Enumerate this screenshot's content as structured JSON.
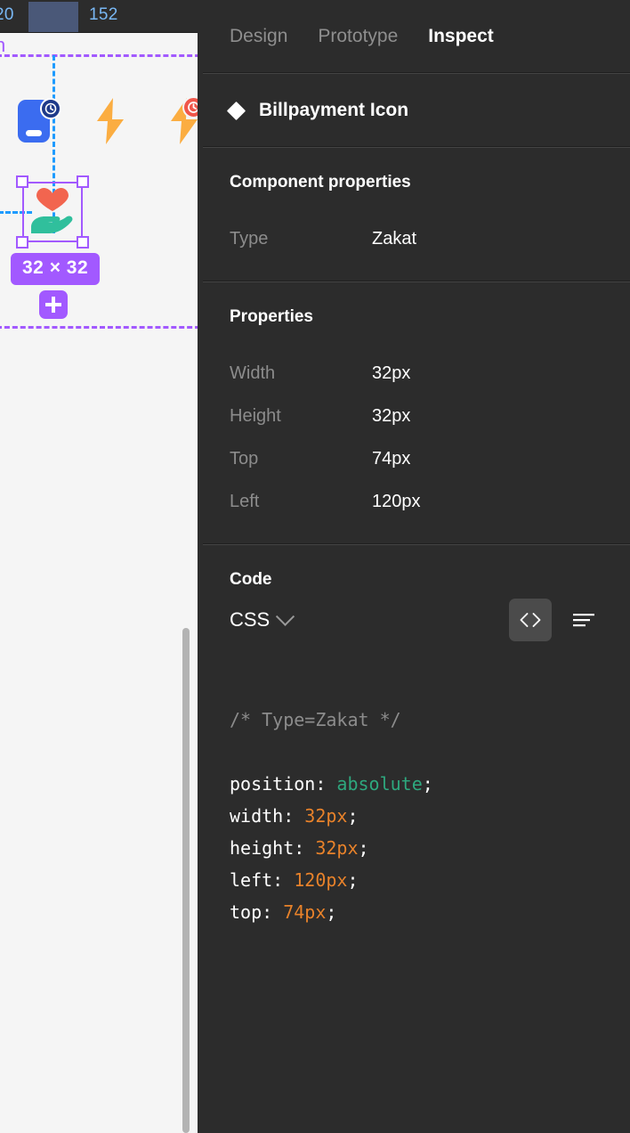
{
  "canvas": {
    "ruler": {
      "tick_left": "20",
      "tick_right": "152"
    },
    "frame_name_fragment": "n",
    "selection": {
      "size_badge": "32 × 32",
      "add_button": "+"
    },
    "icons": [
      "phone-card-icon",
      "lightning-bolt-icon",
      "lightning-bolt-badged-icon",
      "zakat-heart-hand-icon"
    ],
    "colors": {
      "selection_purple": "#a259ff",
      "guide_blue": "#1e9bff",
      "canvas_bg": "#f5f5f5",
      "ruler_highlight": "#4a5878",
      "ruler_text": "#79b8f5"
    }
  },
  "panel": {
    "tabs": [
      {
        "label": "Design",
        "active": false
      },
      {
        "label": "Prototype",
        "active": false
      },
      {
        "label": "Inspect",
        "active": true
      }
    ],
    "component": {
      "name": "Billpayment Icon",
      "icon": "component-diamond-icon"
    },
    "component_properties": {
      "title": "Component properties",
      "rows": [
        {
          "label": "Type",
          "value": "Zakat"
        }
      ]
    },
    "properties": {
      "title": "Properties",
      "rows": [
        {
          "label": "Width",
          "value": "32px"
        },
        {
          "label": "Height",
          "value": "32px"
        },
        {
          "label": "Top",
          "value": "74px"
        },
        {
          "label": "Left",
          "value": "120px"
        }
      ]
    },
    "code": {
      "title": "Code",
      "language": "CSS",
      "comment": "/* Type=Zakat */",
      "lines": [
        {
          "prop": "position: ",
          "value": "absolute",
          "kind": "kw",
          "end": ";"
        },
        {
          "prop": "width: ",
          "value": "32px",
          "kind": "num",
          "end": ";"
        },
        {
          "prop": "height: ",
          "value": "32px",
          "kind": "num",
          "end": ";"
        },
        {
          "prop": "left: ",
          "value": "120px",
          "kind": "num",
          "end": ";"
        },
        {
          "prop": "top: ",
          "value": "74px",
          "kind": "num",
          "end": ";"
        }
      ],
      "actions": [
        {
          "name": "code-view-button",
          "active": true
        },
        {
          "name": "text-view-button",
          "active": false
        }
      ]
    },
    "colors": {
      "panel_bg": "#2c2c2c",
      "label_gray": "#8c8c8c",
      "keyword_green": "#2ea87e",
      "number_orange": "#e8822a"
    }
  }
}
